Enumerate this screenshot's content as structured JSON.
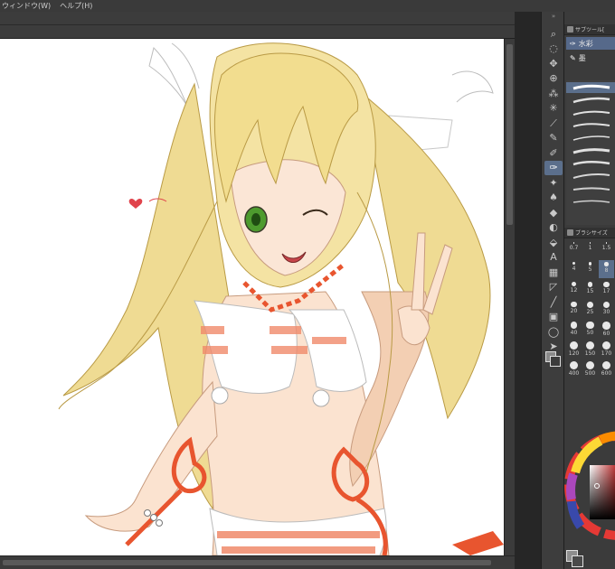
{
  "menu": [
    {
      "label": "ウィンドウ(W)"
    },
    {
      "label": "ヘルプ(H)"
    }
  ],
  "tools": [
    {
      "name": "zoom-tool-icon",
      "glyph": "⌕"
    },
    {
      "name": "lasso-tool-icon",
      "glyph": "◌"
    },
    {
      "name": "move-tool-icon",
      "glyph": "✥"
    },
    {
      "name": "operation-tool-icon",
      "glyph": "⊕"
    },
    {
      "name": "auto-select-icon",
      "glyph": "⁂"
    },
    {
      "name": "sparkle-tool-icon",
      "glyph": "✳"
    },
    {
      "name": "eyedropper-icon",
      "glyph": "⟋"
    },
    {
      "name": "pen-tool-icon",
      "glyph": "✎"
    },
    {
      "name": "pencil-tool-icon",
      "glyph": "✐"
    },
    {
      "name": "brush-tool-icon",
      "glyph": "✑"
    },
    {
      "name": "airbrush-tool-icon",
      "glyph": "✦"
    },
    {
      "name": "decoration-tool-icon",
      "glyph": "♠"
    },
    {
      "name": "eraser-tool-icon",
      "glyph": "◆"
    },
    {
      "name": "blend-tool-icon",
      "glyph": "◐"
    },
    {
      "name": "fill-tool-icon",
      "glyph": "⬙"
    },
    {
      "name": "text-tool-icon",
      "glyph": "A"
    },
    {
      "name": "gradient-tool-icon",
      "glyph": "▦"
    },
    {
      "name": "figure-tool-icon",
      "glyph": "◸"
    },
    {
      "name": "line-tool-icon",
      "glyph": "╱"
    },
    {
      "name": "frame-tool-icon",
      "glyph": "▣"
    },
    {
      "name": "balloon-tool-icon",
      "glyph": "◯"
    },
    {
      "name": "object-tool-icon",
      "glyph": "➤"
    }
  ],
  "active_tool_index": 9,
  "panel": {
    "subtool_tab": "サブツール[",
    "subtools": [
      {
        "label": "水彩",
        "icon": "✑"
      },
      {
        "label": "墨",
        "icon": "✎"
      }
    ],
    "brush_size_tab": "ブラシサイズ",
    "sizes": [
      "0.7",
      "1",
      "1.5",
      "4",
      "5",
      "8",
      "12",
      "15",
      "17",
      "20",
      "25",
      "30",
      "40",
      "50",
      "60",
      "120",
      "150",
      "170",
      "400",
      "500",
      "600"
    ],
    "selected_size_index": 5
  },
  "colors": {
    "accent": "#5b6f8c",
    "background": "#2b2b2b",
    "panel": "#3b3b3b",
    "canvas": "#ffffff"
  }
}
